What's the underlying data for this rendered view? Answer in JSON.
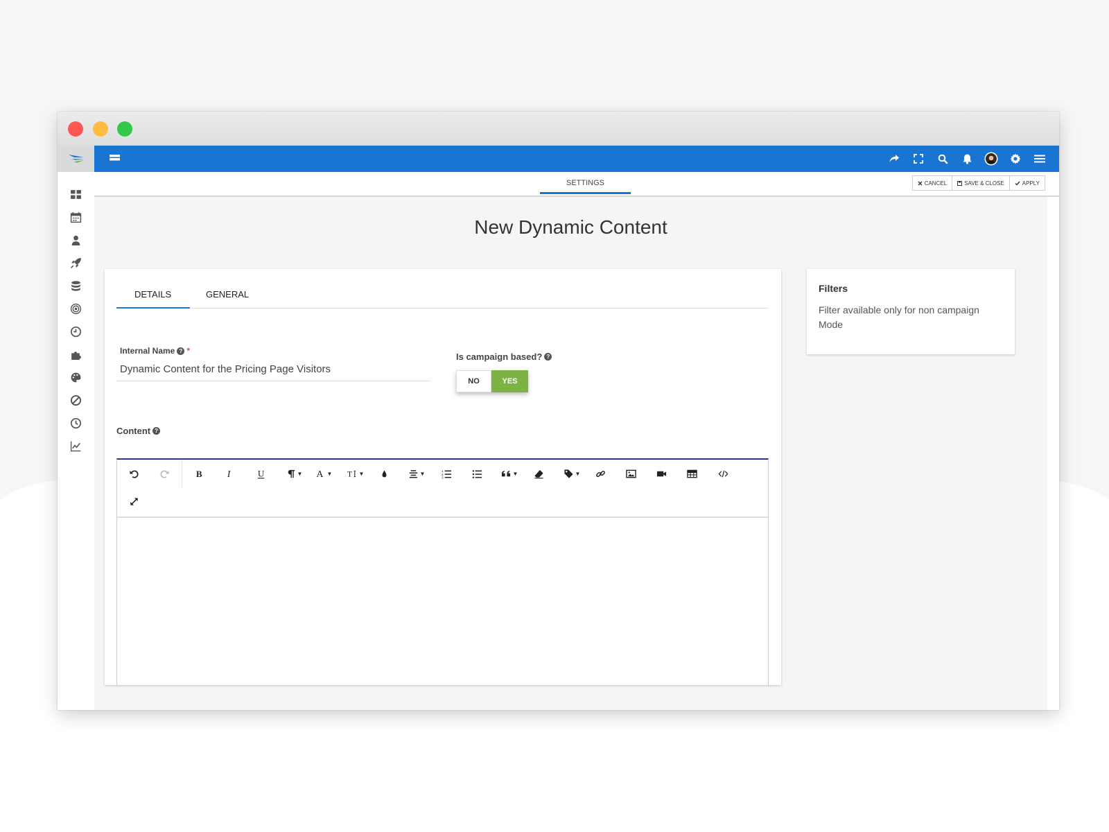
{
  "topbar": {
    "icons": [
      "share-icon",
      "fullscreen-icon",
      "search-icon",
      "bell-icon",
      "avatar",
      "gear-icon",
      "hamburger-icon"
    ]
  },
  "subbar": {
    "tab_label": "SETTINGS",
    "cancel_label": "CANCEL",
    "save_close_label": "SAVE & CLOSE",
    "apply_label": "APPLY"
  },
  "sidebar": {
    "items": [
      "dashboard-icon",
      "calendar-icon",
      "user-icon",
      "rocket-icon",
      "database-icon",
      "target-icon",
      "clock-icon",
      "puzzle-icon",
      "palette-icon",
      "ban-icon",
      "history-icon",
      "chart-line-icon"
    ]
  },
  "page": {
    "title": "New Dynamic Content"
  },
  "form": {
    "tabs": [
      {
        "label": "DETAILS"
      },
      {
        "label": "GENERAL"
      }
    ],
    "internal_name_label": "Internal Name",
    "internal_name_required": "*",
    "internal_name_value": "Dynamic Content for the Pricing Page Visitors",
    "campaign_label": "Is campaign based?",
    "toggle_no": "NO",
    "toggle_yes": "YES",
    "content_label": "Content"
  },
  "filters": {
    "title": "Filters",
    "text": "Filter available only for non campaign Mode"
  },
  "colors": {
    "primary": "#1a74d2",
    "toggle_active": "#7cb342",
    "editor_accent": "#283593"
  }
}
